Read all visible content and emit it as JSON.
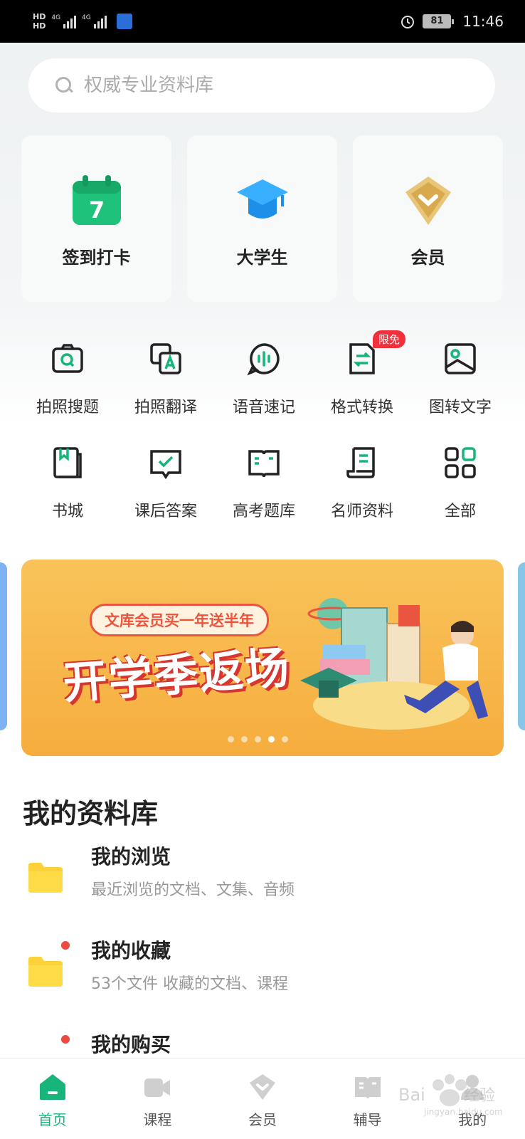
{
  "status_bar": {
    "hd1": "HD",
    "hd2": "HD",
    "net1": "4G",
    "net2": "4G",
    "battery": "81",
    "time": "11:46"
  },
  "search": {
    "placeholder": "权威专业资料库"
  },
  "cards": [
    {
      "label": "签到打卡",
      "icon": "calendar-icon",
      "number": "7"
    },
    {
      "label": "大学生",
      "icon": "graduation-cap-icon"
    },
    {
      "label": "会员",
      "icon": "vip-diamond-icon"
    }
  ],
  "tools": [
    {
      "label": "拍照搜题",
      "icon": "camera-search-icon"
    },
    {
      "label": "拍照翻译",
      "icon": "translate-icon"
    },
    {
      "label": "语音速记",
      "icon": "voice-icon"
    },
    {
      "label": "格式转换",
      "icon": "convert-icon",
      "badge": "限免"
    },
    {
      "label": "图转文字",
      "icon": "image-text-icon"
    },
    {
      "label": "书城",
      "icon": "book-icon"
    },
    {
      "label": "课后答案",
      "icon": "answer-icon"
    },
    {
      "label": "高考题库",
      "icon": "exam-icon"
    },
    {
      "label": "名师资料",
      "icon": "document-icon"
    },
    {
      "label": "全部",
      "icon": "grid-icon"
    }
  ],
  "banner": {
    "tag": "文库会员买一年送半年",
    "title": "开学季返场",
    "dots_total": 5,
    "active_dot": 4
  },
  "library": {
    "title": "我的资料库",
    "items": [
      {
        "name": "我的浏览",
        "desc": "最近浏览的文档、文集、音频"
      },
      {
        "name": "我的收藏",
        "desc": "53个文件 收藏的文档、课程"
      },
      {
        "name": "我的购买",
        "desc": ""
      }
    ]
  },
  "tabbar": [
    {
      "label": "首页",
      "icon": "home-icon",
      "active": true
    },
    {
      "label": "课程",
      "icon": "video-icon"
    },
    {
      "label": "会员",
      "icon": "vip-icon"
    },
    {
      "label": "辅导",
      "icon": "tutor-icon"
    },
    {
      "label": "我的",
      "icon": "profile-icon"
    }
  ],
  "colors": {
    "accent": "#17b57a",
    "badge": "#f0303a",
    "banner": "#f7b244"
  }
}
